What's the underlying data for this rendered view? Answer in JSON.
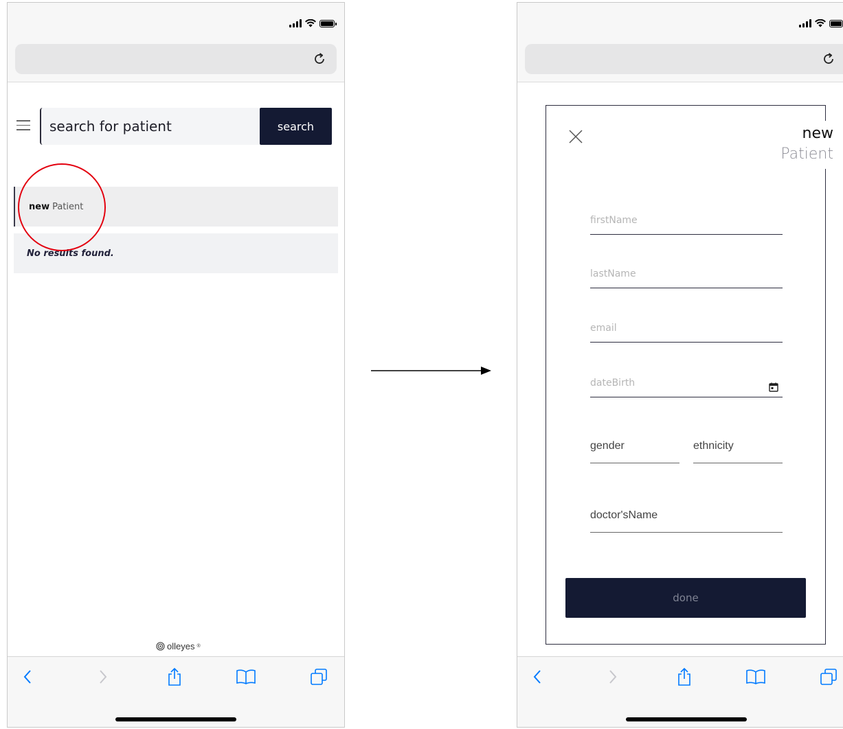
{
  "left_screen": {
    "search": {
      "placeholder": "search for patient",
      "button_label": "search"
    },
    "results": {
      "new_item": {
        "bold": "new",
        "rest": "Patient"
      },
      "empty_message": "No results found."
    },
    "brand": {
      "name": "olleyes",
      "mark": "®"
    }
  },
  "right_screen": {
    "modal": {
      "title_line1": "new",
      "title_line2": "Patient",
      "fields": {
        "first_name_placeholder": "firstName",
        "last_name_placeholder": "lastName",
        "email_placeholder": "email",
        "date_birth_placeholder": "dateBirth",
        "gender_label": "gender",
        "ethnicity_label": "ethnicity",
        "doctor_label": "doctor'sName"
      },
      "done_label": "done"
    }
  },
  "icons": {
    "status": [
      "signal-icon",
      "wifi-icon",
      "battery-icon"
    ],
    "url_bar": [
      "reload-icon"
    ],
    "toolbar": [
      "back-icon",
      "forward-icon",
      "share-icon",
      "bookmarks-icon",
      "tabs-icon"
    ],
    "modal": [
      "close-icon",
      "calendar-icon"
    ]
  },
  "colors": {
    "primary_dark": "#141a33",
    "highlight_circle": "#e3000f",
    "safari_blue": "#007aff",
    "safari_disabled": "#c7c7cc"
  }
}
